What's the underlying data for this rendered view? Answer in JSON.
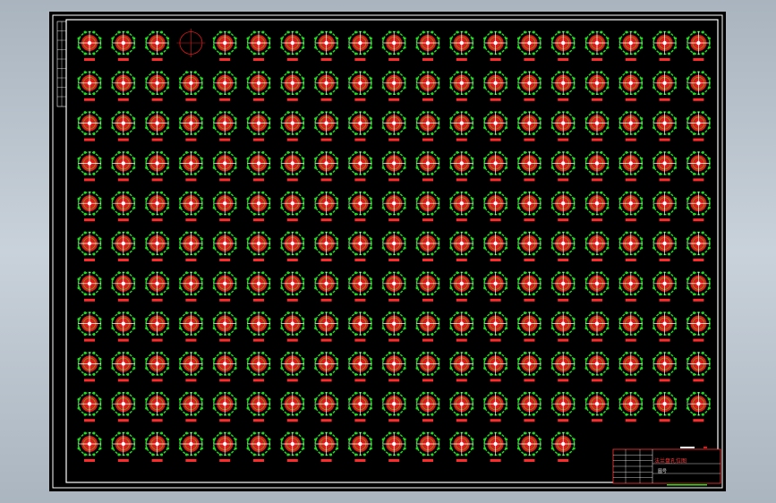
{
  "drawing": {
    "rows": 11,
    "cols": 19,
    "cells_in_last_row": 15,
    "empty_cell": {
      "row": 0,
      "col": 3
    },
    "colors": {
      "background": "#000000",
      "frame": "#ffffff",
      "outer_ring": "#22dd22",
      "inner_fill": "#e01818",
      "crosshair": "#ffffff",
      "label": "#ff2b2b",
      "title_block_border": "#ff3333"
    }
  },
  "title_block": {
    "title": "法兰盘孔位图",
    "drawing_no": "图号"
  }
}
